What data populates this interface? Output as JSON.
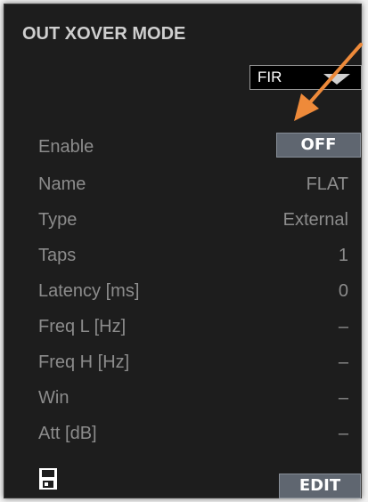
{
  "title": "OUT XOVER MODE",
  "mode_dropdown": {
    "selected": "FIR"
  },
  "rows": [
    {
      "label": "Enable",
      "value": ""
    },
    {
      "label": "Name",
      "value": "FLAT"
    },
    {
      "label": "Type",
      "value": "External"
    },
    {
      "label": "Taps",
      "value": "1"
    },
    {
      "label": "Latency [ms]",
      "value": "0"
    },
    {
      "label": "Freq L [Hz]",
      "value": "–"
    },
    {
      "label": "Freq H [Hz]",
      "value": "–"
    },
    {
      "label": "Win",
      "value": "–"
    },
    {
      "label": "Att [dB]",
      "value": "–"
    }
  ],
  "enable_button": {
    "label": "OFF"
  },
  "edit_button": {
    "label": "EDIT"
  },
  "icons": {
    "save": "floppy-disk-icon",
    "callout": "orange-arrow-icon"
  },
  "colors": {
    "panel": "#1d1d1d",
    "text": "#8c8c8c",
    "button": "#5f6670",
    "callout": "#ee8a3a"
  }
}
